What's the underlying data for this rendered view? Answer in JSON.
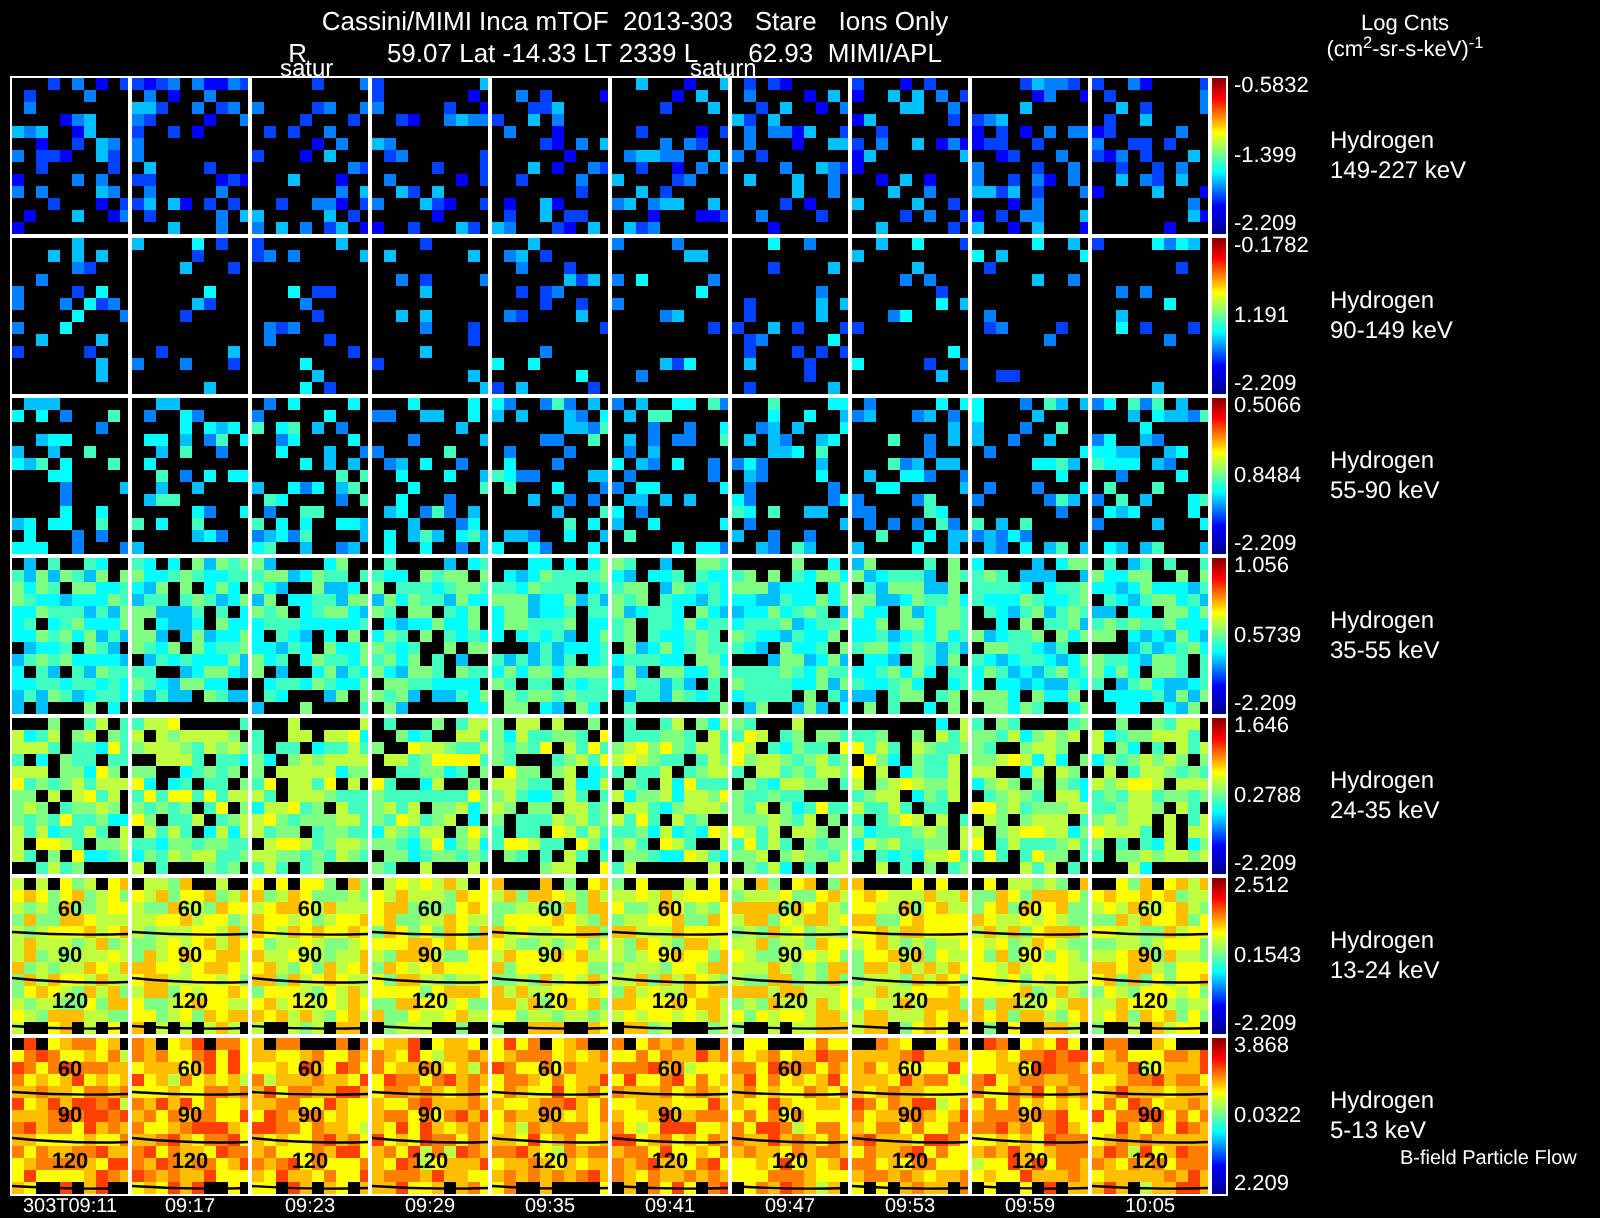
{
  "title": "Cassini/MIMI Inca mTOF  2013-303   Stare   Ions Only",
  "subtitle": [
    "R",
    "59.07 Lat -14.33 LT 2339 L",
    "62.93  MIMI/APL"
  ],
  "column_notes": [
    "satur",
    "saturn"
  ],
  "unit_label": {
    "name": "Log Cnts",
    "units": "(cm$^{2}$-sr-s-keV)$^{-1}$"
  },
  "rows": [
    {
      "species": "Hydrogen",
      "energy": "149-227 keV",
      "max": "-0.5832",
      "mid": "-1.399",
      "min": "-2.209"
    },
    {
      "species": "Hydrogen",
      "energy": "90-149 keV",
      "max": "-0.1782",
      "mid": "1.191",
      "min": "-2.209"
    },
    {
      "species": "Hydrogen",
      "energy": "55-90 keV",
      "max": "0.5066",
      "mid": "0.8484",
      "min": "-2.209"
    },
    {
      "species": "Hydrogen",
      "energy": "35-55 keV",
      "max": "1.056",
      "mid": "0.5739",
      "min": "-2.209"
    },
    {
      "species": "Hydrogen",
      "energy": "24-35 keV",
      "max": "1.646",
      "mid": "0.2788",
      "min": "-2.209"
    },
    {
      "species": "Hydrogen",
      "energy": "13-24 keV",
      "max": "2.512",
      "mid": "0.1543",
      "min": "-2.209",
      "panels": [
        {
          "labels": [
            "60",
            "90",
            "120"
          ]
        },
        {
          "labels": [
            "60",
            "90",
            "120"
          ]
        },
        {
          "labels": [
            "60",
            "90",
            "120"
          ]
        },
        {
          "labels": [
            "60",
            "90",
            "120"
          ]
        },
        {
          "labels": [
            "60",
            "90",
            "120"
          ]
        },
        {
          "labels": [
            "60",
            "90",
            "120"
          ]
        },
        {
          "labels": [
            "60",
            "90",
            "120"
          ]
        },
        {
          "labels": [
            "60",
            "90",
            "120"
          ]
        },
        {
          "labels": [
            "60",
            "90",
            "120"
          ]
        },
        {
          "labels": [
            "60",
            "90",
            "120"
          ]
        }
      ]
    },
    {
      "species": "Hydrogen",
      "energy": "5-13 keV",
      "max": "3.868",
      "mid": "0.0322",
      "min": "2.209",
      "panels": [
        {
          "labels": [
            "60",
            "90",
            "120"
          ]
        },
        {
          "labels": [
            "60",
            "90",
            "120"
          ]
        },
        {
          "labels": [
            "60",
            "90",
            "120"
          ]
        },
        {
          "labels": [
            "60",
            "90",
            "120"
          ]
        },
        {
          "labels": [
            "60",
            "90",
            "120"
          ]
        },
        {
          "labels": [
            "60",
            "90",
            "120"
          ]
        },
        {
          "labels": [
            "60",
            "90",
            "120"
          ]
        },
        {
          "labels": [
            "60",
            "90",
            "120"
          ]
        },
        {
          "labels": [
            "60",
            "90",
            "120"
          ]
        },
        {
          "labels": [
            "60",
            "90",
            "120"
          ]
        }
      ]
    }
  ],
  "footnote": "B-field Particle Flow",
  "times": [
    "303T09:11",
    "09:17",
    "09:23",
    "09:29",
    "09:35",
    "09:41",
    "09:47",
    "09:53",
    "09:59",
    "10:05"
  ]
}
